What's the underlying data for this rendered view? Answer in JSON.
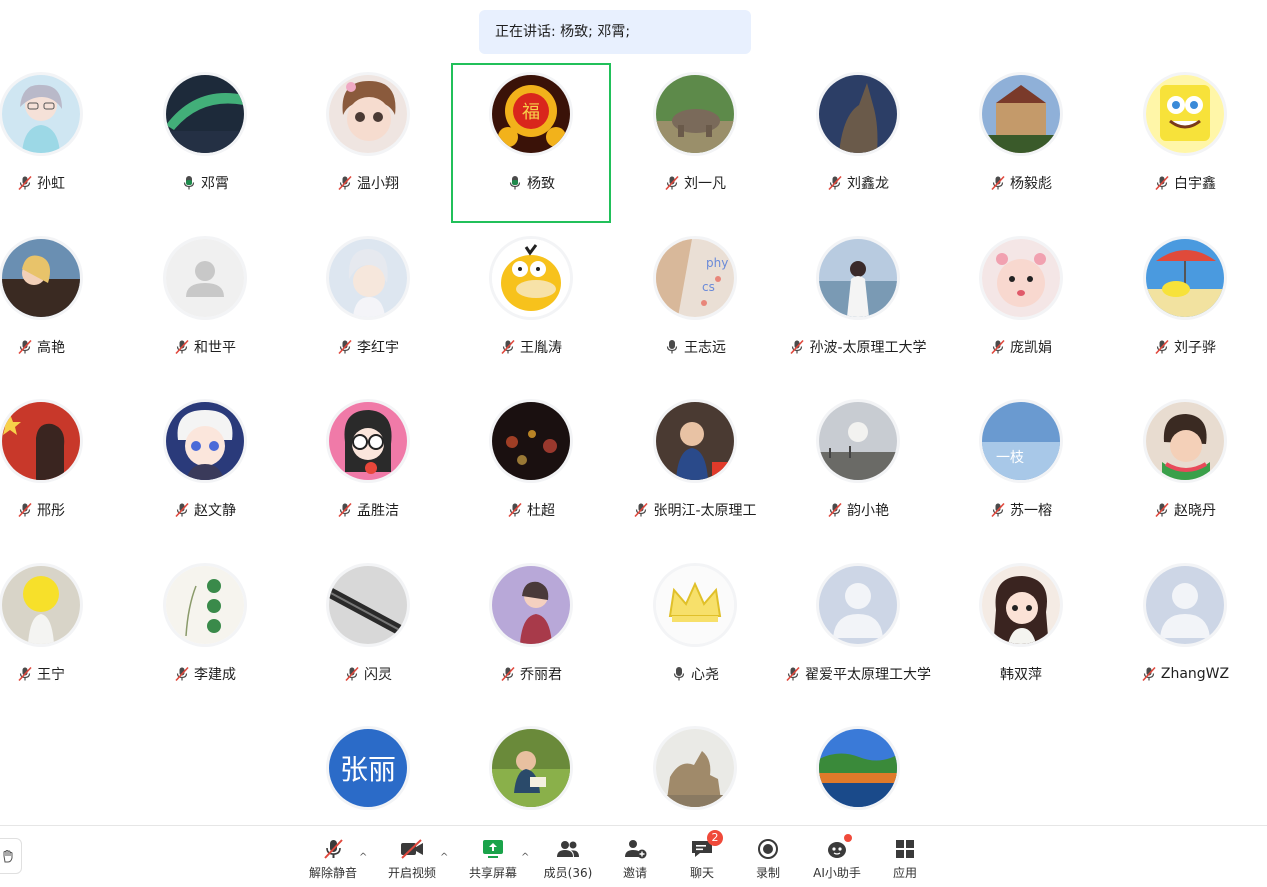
{
  "speaking": {
    "text": "正在讲话: 杨致; 邓霄;"
  },
  "participants": [
    {
      "name": "孙虹",
      "mic": "muted"
    },
    {
      "name": "邓霄",
      "mic": "speaking"
    },
    {
      "name": "温小翔",
      "mic": "muted"
    },
    {
      "name": "杨致",
      "mic": "speaking"
    },
    {
      "name": "刘一凡",
      "mic": "muted"
    },
    {
      "name": "刘鑫龙",
      "mic": "muted"
    },
    {
      "name": "杨毅彪",
      "mic": "muted"
    },
    {
      "name": "白宇鑫",
      "mic": "muted"
    },
    {
      "name": "高艳",
      "mic": "muted"
    },
    {
      "name": "和世平",
      "mic": "muted"
    },
    {
      "name": "李红宇",
      "mic": "muted"
    },
    {
      "name": "王胤涛",
      "mic": "muted"
    },
    {
      "name": "王志远",
      "mic": "on"
    },
    {
      "name": "孙波-太原理工大学",
      "mic": "muted"
    },
    {
      "name": "庞凯娟",
      "mic": "muted"
    },
    {
      "name": "刘子骅",
      "mic": "muted"
    },
    {
      "name": "邢彤",
      "mic": "muted"
    },
    {
      "name": "赵文静",
      "mic": "muted"
    },
    {
      "name": "孟胜洁",
      "mic": "muted"
    },
    {
      "name": "杜超",
      "mic": "muted"
    },
    {
      "name": "张明江-太原理工",
      "mic": "muted"
    },
    {
      "name": "韵小艳",
      "mic": "muted"
    },
    {
      "name": "苏一榕",
      "mic": "muted"
    },
    {
      "name": "赵晓丹",
      "mic": "muted"
    },
    {
      "name": "王宁",
      "mic": "muted"
    },
    {
      "name": "李建成",
      "mic": "muted"
    },
    {
      "name": "闪灵",
      "mic": "muted"
    },
    {
      "name": "乔丽君",
      "mic": "muted"
    },
    {
      "name": "心尧",
      "mic": "on"
    },
    {
      "name": "翟爱平太原理工大学",
      "mic": "muted"
    },
    {
      "name": "韩双萍",
      "mic": "none"
    },
    {
      "name": "ZhangWZ",
      "mic": "muted"
    },
    {
      "name": "",
      "mic": "none",
      "avatar_text": "张丽"
    },
    {
      "name": "",
      "mic": "none"
    },
    {
      "name": "",
      "mic": "none"
    },
    {
      "name": "",
      "mic": "none"
    }
  ],
  "active_speaker_index": 3,
  "toolbar": {
    "unmute": "解除静音",
    "video": "开启视频",
    "share": "共享屏幕",
    "members": "成员(36)",
    "invite": "邀请",
    "chat": "聊天",
    "chat_badge": "2",
    "record": "录制",
    "ai": "AI小助手",
    "apps": "应用"
  },
  "colors": {
    "active_border": "#21c05a",
    "muted_icon": "#e0483d",
    "speaking_icon": "#1f8a4c",
    "share_icon": "#1aa34a",
    "banner_bg": "#e8f0fe"
  }
}
